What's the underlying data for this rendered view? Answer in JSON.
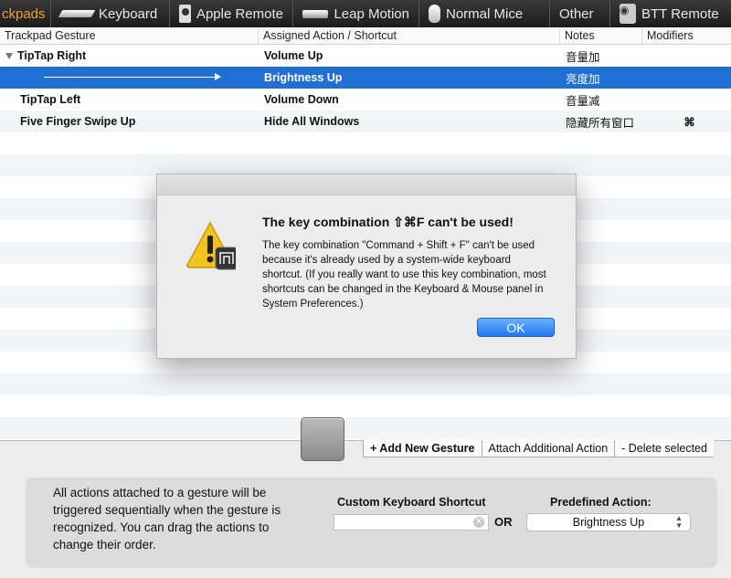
{
  "toolbar": {
    "tabs": [
      {
        "label": "ckpads",
        "icon": "trackpad-icon",
        "active": true
      },
      {
        "label": "Keyboard",
        "icon": "keyboard-icon"
      },
      {
        "label": "Apple Remote",
        "icon": "remote-icon"
      },
      {
        "label": "Leap Motion",
        "icon": "leap-motion-icon"
      },
      {
        "label": "Normal Mice",
        "icon": "mouse-icon"
      },
      {
        "label": "Other"
      },
      {
        "label": "BTT Remote",
        "icon": "btt-remote-icon"
      }
    ]
  },
  "table": {
    "columns": [
      "Trackpad Gesture",
      "Assigned Action / Shortcut",
      "Notes",
      "Modifiers"
    ],
    "rows": [
      {
        "gesture": "TipTap Right",
        "action": "Volume Up",
        "notes": "音量加",
        "modifiers": ""
      },
      {
        "gesture": "",
        "action": "Brightness Up",
        "notes": "亮度加",
        "modifiers": ""
      },
      {
        "gesture": "TipTap Left",
        "action": "Volume Down",
        "notes": "音量减",
        "modifiers": ""
      },
      {
        "gesture": "Five Finger Swipe Up",
        "action": "Hide All Windows",
        "notes": "隐藏所有窗口",
        "modifiers": "⌘"
      }
    ]
  },
  "dialog": {
    "title": "The key combination ⇧⌘F can't be used!",
    "message": "The key combination \"Command + Shift + F\" can't be used because it's already used by a system-wide keyboard shortcut. (If you really want to use this key combination, most shortcuts can be changed in the Keyboard & Mouse panel in System Preferences.)",
    "ok_label": "OK"
  },
  "actions": {
    "add_label": "+ Add New Gesture",
    "attach_label": "Attach Additional Action",
    "delete_label": "- Delete selected"
  },
  "bottom": {
    "info": "All actions attached to a gesture will be triggered sequentially when the gesture is recognized. You can drag the actions to change their order.",
    "custom_label": "Custom Keyboard Shortcut",
    "or_label": "OR",
    "predefined_label": "Predefined Action:",
    "predefined_value": "Brightness Up"
  },
  "colors": {
    "selection": "#1f6fd5",
    "accent_tab": "#f0a030",
    "ok_button": "#2277ee"
  }
}
